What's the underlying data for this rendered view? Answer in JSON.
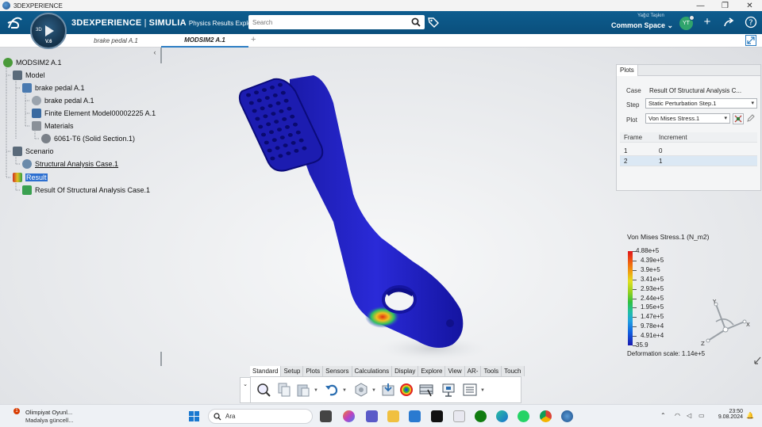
{
  "window": {
    "title": "3DEXPERIENCE",
    "minimize": "—",
    "maximize": "❐",
    "close": "✕"
  },
  "topbar": {
    "brand_main": "3DEXPERIENCE",
    "brand_sep": " | ",
    "brand_app": "SIMULIA",
    "brand_sub": "Physics Results Explorer",
    "compass_version": "V.6",
    "compass_3d": "3D",
    "search_placeholder": "Search",
    "user_name": "Yağız Taşkın",
    "space": "Common Space",
    "space_chevron": "⌄",
    "avatar_initials": "YT",
    "colors": {
      "bar": "#0a4f7c",
      "accent": "#2c7ec4"
    }
  },
  "tabs": [
    {
      "label": "brake pedal A.1"
    },
    {
      "label": "MODSIM2 A.1"
    }
  ],
  "tab_add": "+",
  "tree": {
    "collapse_glyph": "‹",
    "items": [
      {
        "label": "MODSIM2 A.1",
        "icon": "product-icon"
      },
      {
        "label": "Model",
        "icon": "model-icon"
      },
      {
        "label": "brake pedal A.1",
        "icon": "part-icon"
      },
      {
        "label": "brake pedal A.1",
        "icon": "part-instance-icon"
      },
      {
        "label": "Finite Element Model00002225 A.1",
        "icon": "fem-icon"
      },
      {
        "label": "Materials",
        "icon": "materials-icon"
      },
      {
        "label": "6061-T6 (Solid Section.1)",
        "icon": "material-icon"
      },
      {
        "label": "Scenario",
        "icon": "scenario-icon"
      },
      {
        "label": "Structural Analysis Case.1",
        "icon": "analysis-case-icon"
      },
      {
        "label": "Result",
        "icon": "result-icon"
      },
      {
        "label": "Result Of Structural Analysis Case.1",
        "icon": "result-case-icon"
      }
    ]
  },
  "plots_panel": {
    "title": "Plots",
    "case_label": "Case",
    "case_value": "Result Of Structural Analysis C...",
    "step_label": "Step",
    "step_value": "Static Perturbation Step.1",
    "plot_label": "Plot",
    "plot_value": "Von Mises Stress.1",
    "table_headers": [
      "Frame",
      "Increment"
    ],
    "table_rows": [
      [
        "1",
        "0"
      ],
      [
        "2",
        "1"
      ]
    ],
    "selected_row": 1
  },
  "legend": {
    "title": "Von Mises Stress.1 (N_m2)",
    "values": [
      "4.88e+5",
      "4.39e+5",
      "3.9e+5",
      "3.41e+5",
      "2.93e+5",
      "2.44e+5",
      "1.95e+5",
      "1.47e+5",
      "9.78e+4",
      "4.91e+4",
      "35.9"
    ],
    "deformation": "Deformation scale: 1.14e+5"
  },
  "triad": {
    "x": "X",
    "y": "Y",
    "z": "Z"
  },
  "action_bar": {
    "tabs": [
      "Standard",
      "Setup",
      "Plots",
      "Sensors",
      "Calculations",
      "Display",
      "Explore",
      "View",
      "AR-VR",
      "Tools",
      "Touch"
    ],
    "active_tab": "Standard"
  },
  "taskbar": {
    "news_title": "Olimpiyat Oyunl...",
    "news_sub": "Madalya güncell...",
    "news_badge": "1",
    "search_text": "Ara",
    "time": "23:50",
    "date": "9.08.2024"
  }
}
